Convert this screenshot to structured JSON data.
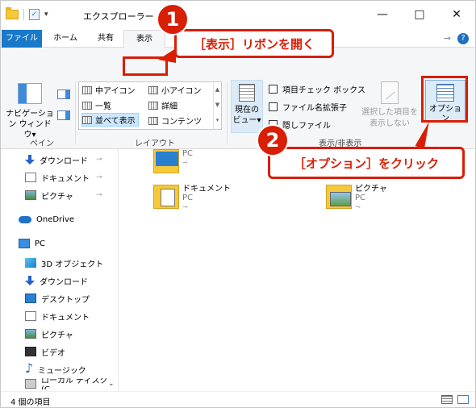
{
  "window": {
    "title": "エクスプローラー",
    "controls": {
      "minimize": "—",
      "maximize": "□",
      "close": "✕"
    }
  },
  "quick_access": {
    "check": "✓",
    "caret": "▾"
  },
  "tabs": {
    "file": "ファイル",
    "home": "ホーム",
    "share": "共有",
    "view": "表示"
  },
  "tab_right": {
    "pin": "⊸",
    "help": "?"
  },
  "ribbon": {
    "pane_group": {
      "label": "ペイン",
      "nav_pane": "ナビゲーション ウィンドウ▾"
    },
    "layout_group": {
      "label": "レイアウト",
      "items": [
        "中アイコン",
        "小アイコン",
        "一覧",
        "詳細",
        "並べて表示",
        "コンテンツ"
      ]
    },
    "current_view": {
      "label": "現在の ビュー▾"
    },
    "show_hide": {
      "label": "表示/非表示",
      "checkboxes": [
        "項目チェック ボックス",
        "ファイル名拡張子",
        "隠しファイル"
      ],
      "hide_selected": "選択した項目を 表示しない"
    },
    "options": "オプション"
  },
  "nav": {
    "items": [
      {
        "label": "ダウンロード",
        "pin": true,
        "icon": "download-icon"
      },
      {
        "label": "ドキュメント",
        "pin": true,
        "icon": "document-icon"
      },
      {
        "label": "ピクチャ",
        "pin": true,
        "icon": "pictures-icon"
      },
      {
        "label": "OneDrive",
        "icon": "onedrive-icon"
      },
      {
        "label": "PC",
        "icon": "pc-icon"
      },
      {
        "label": "3D オブジェクト",
        "icon": "3d-objects-icon"
      },
      {
        "label": "ダウンロード",
        "icon": "download-icon"
      },
      {
        "label": "デスクトップ",
        "icon": "desktop-icon"
      },
      {
        "label": "ドキュメント",
        "icon": "document-icon"
      },
      {
        "label": "ピクチャ",
        "icon": "pictures-icon"
      },
      {
        "label": "ビデオ",
        "icon": "video-icon"
      },
      {
        "label": "ミュージック",
        "icon": "music-icon"
      },
      {
        "label": "ローカル ディスク (C",
        "icon": "drive-icon"
      }
    ],
    "pin_glyph": "📌",
    "scroll_down": "⌄"
  },
  "files": [
    {
      "name": "",
      "location": "PC"
    },
    {
      "name": "ドキュメント",
      "location": "PC"
    },
    {
      "name": "ピクチャ",
      "location": "PC"
    }
  ],
  "status": {
    "count": "4 個の項目"
  },
  "callouts": {
    "one": {
      "number": "1",
      "text": "［表示］リボンを開く"
    },
    "two": {
      "number": "2",
      "text": "［オプション］をクリック"
    }
  },
  "colors": {
    "accent": "#1979ca",
    "callout": "#d81e05",
    "folder": "#f5c93a"
  }
}
